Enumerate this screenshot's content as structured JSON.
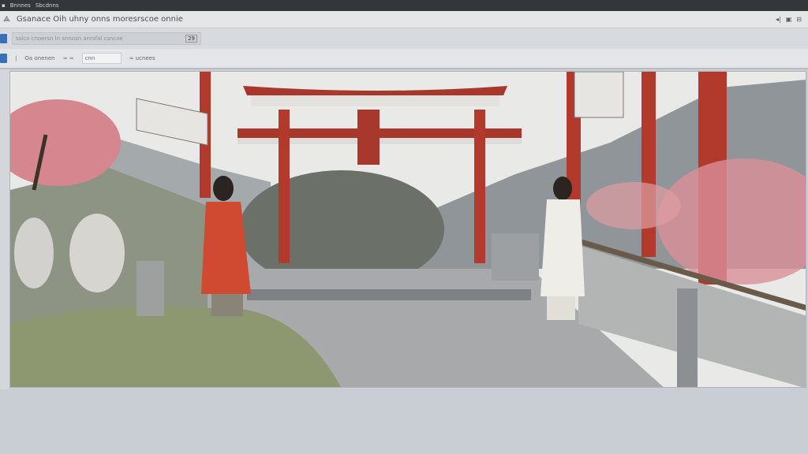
{
  "topbar": {
    "items": [
      "Bnnnes",
      "Sbcdnns"
    ]
  },
  "window": {
    "title": "Gsanace Oih uhny onns moresrscoe onnie"
  },
  "address": {
    "value": "sslco cnoersn ln snnosn anrsfal csncoe",
    "badge": "29"
  },
  "toolbar": {
    "item1": "Oa onenen",
    "item2": "≈ ≈",
    "input_value": "cnn",
    "item3": "≈ ucnees"
  },
  "canvas": {
    "scene": "torii-gate-illustration"
  }
}
